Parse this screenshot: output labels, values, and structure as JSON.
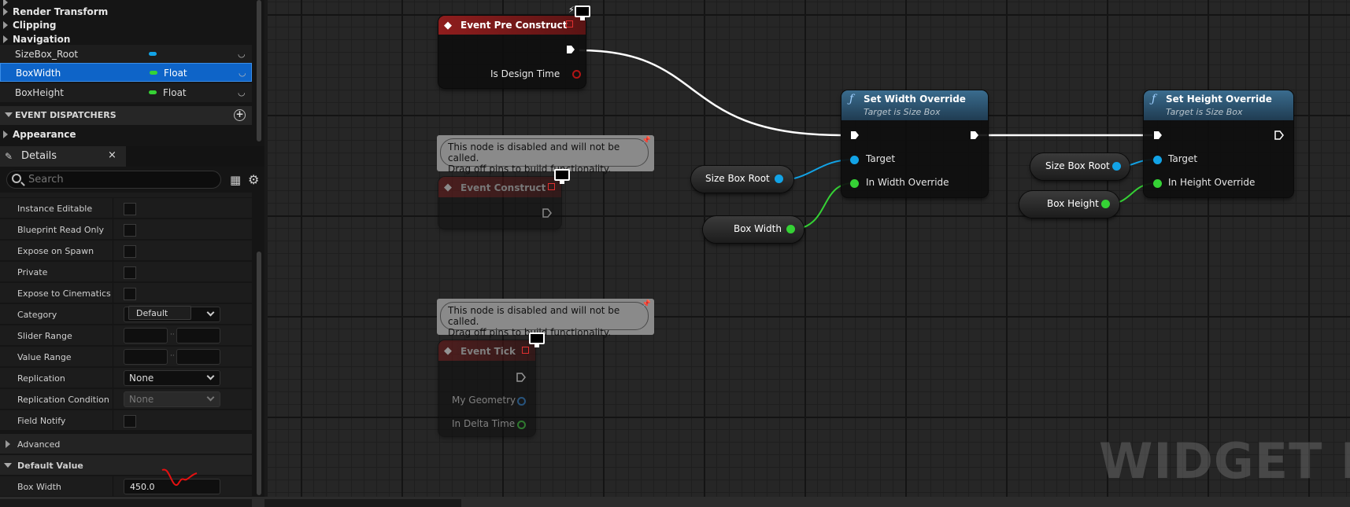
{
  "left_tree": {
    "render_transform": "Render Transform",
    "clipping": "Clipping",
    "navigation": "Navigation"
  },
  "variables": [
    {
      "name": "SizeBox_Root",
      "type": "",
      "pill_color": "#12a3e6"
    },
    {
      "name": "BoxWidth",
      "type": "Float",
      "pill_color": "#35d235"
    },
    {
      "name": "BoxHeight",
      "type": "Float",
      "pill_color": "#35d235"
    }
  ],
  "sections": {
    "event_dispatchers": "EVENT DISPATCHERS",
    "appearance": "Appearance"
  },
  "details": {
    "tab_label": "Details",
    "close": "×",
    "search_placeholder": "Search",
    "rows": {
      "instance_editable": "Instance Editable",
      "blueprint_read_only": "Blueprint Read Only",
      "expose_on_spawn": "Expose on Spawn",
      "private": "Private",
      "expose_to_cinematics": "Expose to Cinematics",
      "category": "Category",
      "category_value": "Default",
      "slider_range": "Slider Range",
      "value_range": "Value Range",
      "replication": "Replication",
      "replication_value": "None",
      "replication_condition": "Replication Condition",
      "replication_condition_value": "None",
      "field_notify": "Field Notify",
      "advanced": "Advanced",
      "default_value": "Default Value",
      "box_width": "Box Width",
      "box_width_value": "450.0"
    }
  },
  "graph": {
    "event_pre_construct": {
      "title": "Event Pre Construct",
      "pin_is_design_time": "Is Design Time"
    },
    "comment_text_1": "This node is disabled and will not be called.",
    "comment_text_2": "Drag off pins to build functionality.",
    "event_construct": {
      "title": "Event Construct"
    },
    "event_tick": {
      "title": "Event Tick",
      "pin_my_geometry": "My Geometry",
      "pin_in_delta_time": "In Delta Time"
    },
    "set_width_override": {
      "title": "Set Width Override",
      "subtitle": "Target is Size Box",
      "pin_target": "Target",
      "pin_in_width": "In Width Override"
    },
    "set_height_override": {
      "title": "Set Height Override",
      "subtitle": "Target is Size Box",
      "pin_target": "Target",
      "pin_in_height": "In Height Override"
    },
    "var_size_box_root_1": "Size Box Root",
    "var_box_width": "Box Width",
    "var_size_box_root_2": "Size Box Root",
    "var_box_height": "Box Height",
    "watermark": "WIDGET BLU"
  },
  "colors": {
    "event_red": "#8c1c1c",
    "function_blue": "#2e5a7a",
    "object_pin": "#12a3e6",
    "float_pin": "#35d235",
    "selection": "#0e64c8"
  }
}
